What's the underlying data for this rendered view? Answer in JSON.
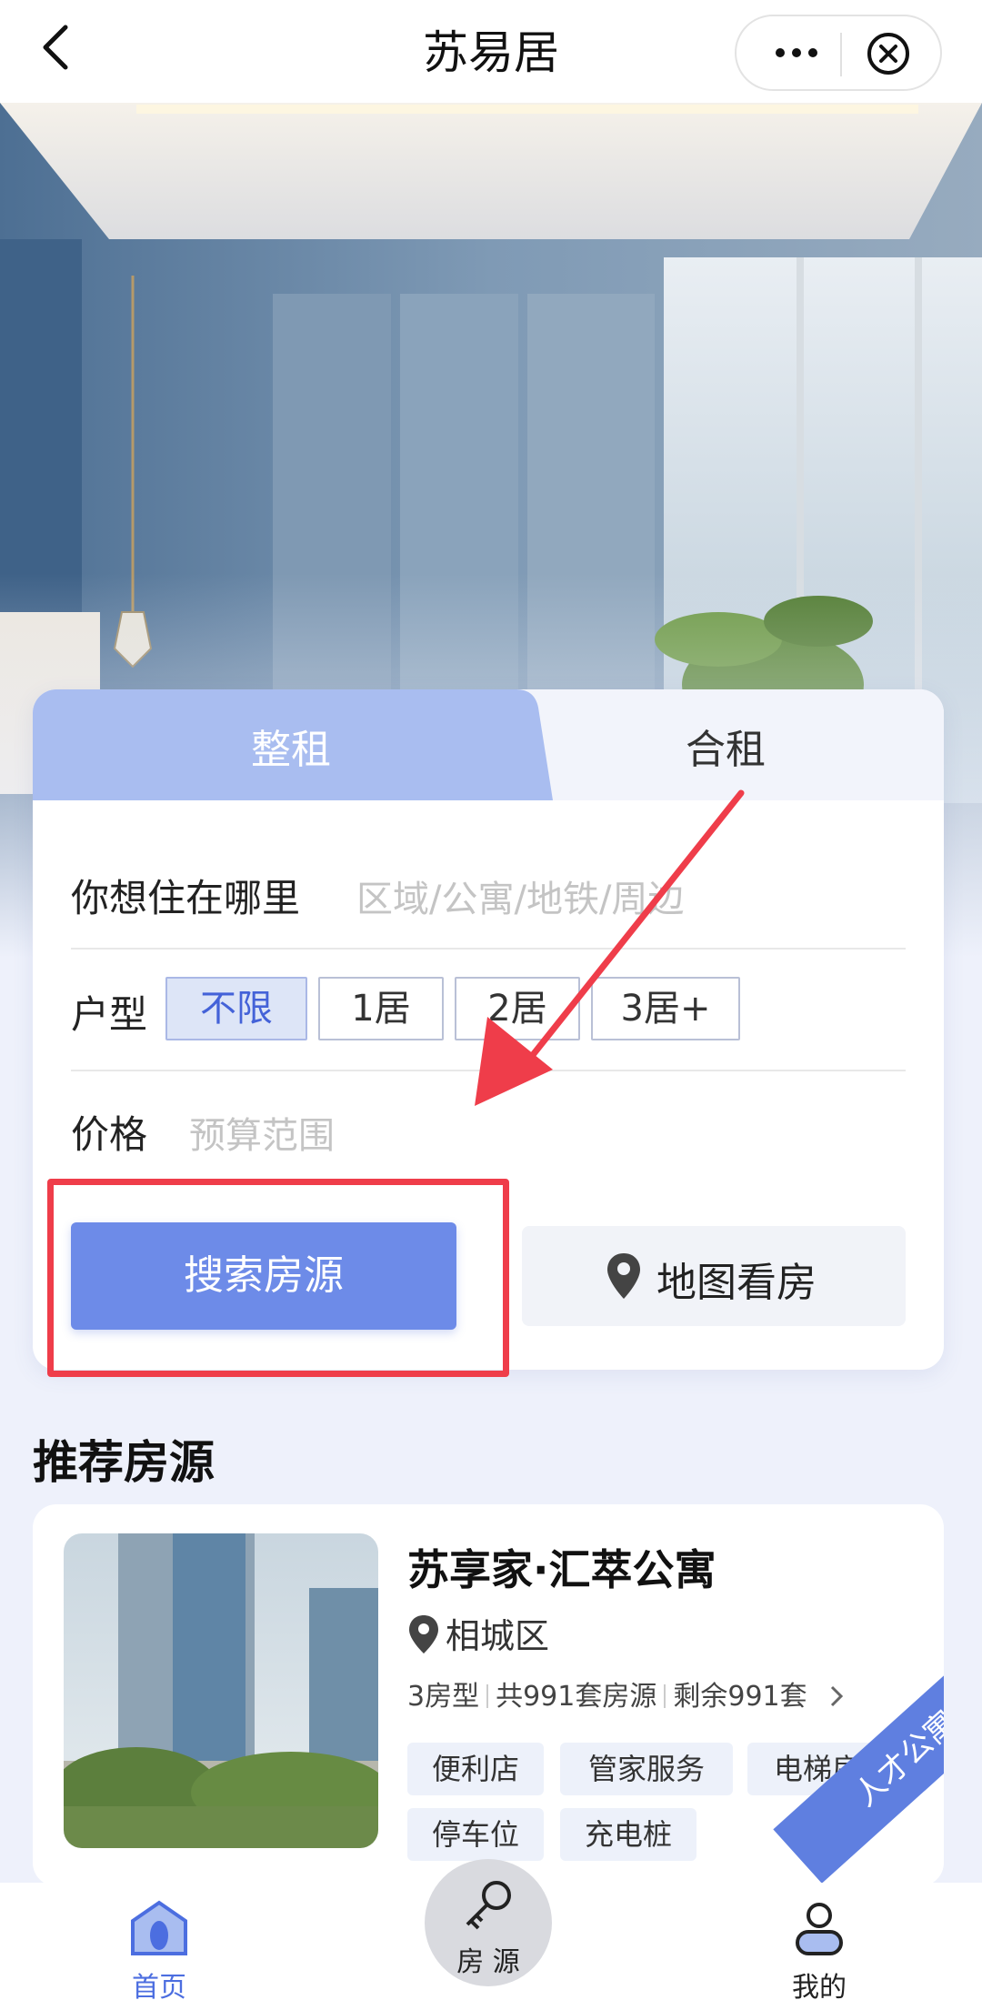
{
  "nav": {
    "title": "苏易居",
    "back_icon": "chevron-left-icon",
    "more_icon": "more-dots-icon",
    "close_icon": "close-circle-icon"
  },
  "search": {
    "tabs": [
      {
        "label": "整租",
        "active": true
      },
      {
        "label": "合租",
        "active": false
      }
    ],
    "location_label": "你想住在哪里",
    "location_placeholder": "区域/公寓/地铁/周边",
    "layout_label": "户型",
    "layout_options": [
      {
        "label": "不限",
        "selected": true
      },
      {
        "label": "1居"
      },
      {
        "label": "2居"
      },
      {
        "label": "3居+"
      }
    ],
    "price_label": "价格",
    "price_placeholder": "预算范围",
    "search_button": "搜索房源",
    "map_button": "地图看房"
  },
  "recommended": {
    "title": "推荐房源",
    "item": {
      "name": "苏享家·汇萃公寓",
      "district": "相城区",
      "types": "3房型",
      "total": "共991套房源",
      "remaining": "剩余991套",
      "tags": [
        "便利店",
        "管家服务",
        "电梯房",
        "停车位",
        "充电桩"
      ],
      "ribbon": "人才公寓"
    }
  },
  "tabbar": {
    "home": "首页",
    "listings": "房 源",
    "me": "我的"
  },
  "colors": {
    "accent": "#6d8be8",
    "highlight": "#ef3d4a",
    "tab_active": "#a9bdf0"
  }
}
